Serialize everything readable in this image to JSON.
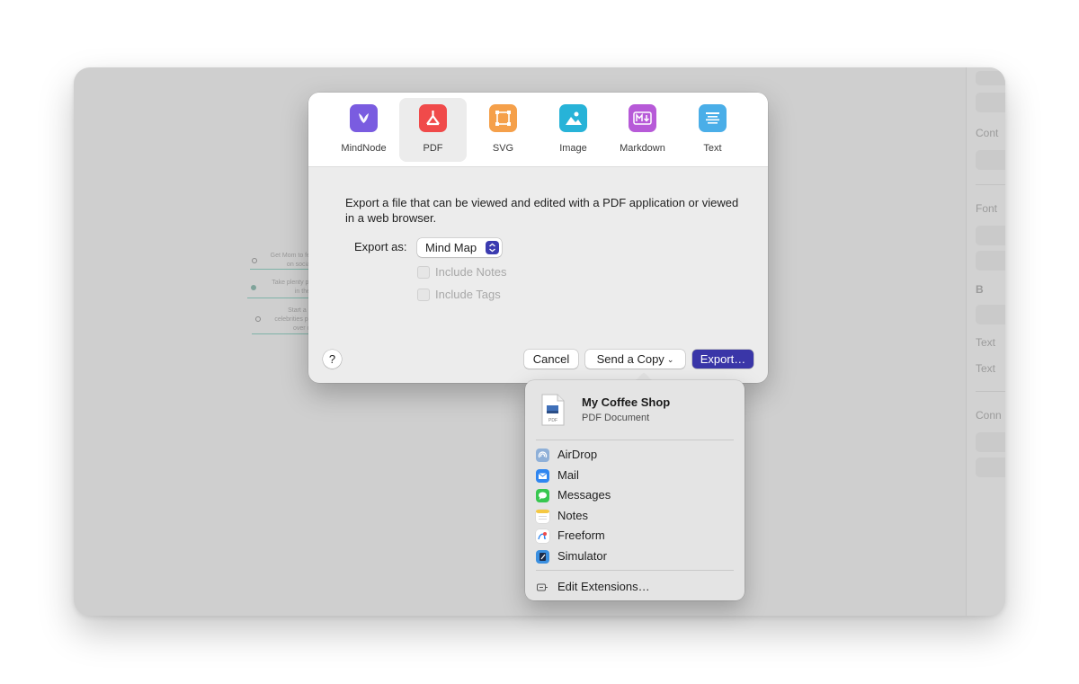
{
  "background_window": {
    "inspector_labels": [
      "Cont",
      "Font",
      "B",
      "Text",
      "Text",
      "Conn"
    ],
    "mindmap_nodes": [
      {
        "text": "Get Mom to fe",
        "text2": "on socia"
      },
      {
        "text": "Take plenty pi",
        "text2": "in the"
      },
      {
        "text": "Start a r",
        "text2": "celebrities pr",
        "text3": "over c"
      }
    ]
  },
  "dialog": {
    "tabs": [
      {
        "label": "MindNode",
        "icon": "mindnode-icon",
        "color": "#7a5ce0"
      },
      {
        "label": "PDF",
        "icon": "pdf-icon",
        "color": "#f04a4a",
        "selected": true
      },
      {
        "label": "SVG",
        "icon": "svg-icon",
        "color": "#f5a04a"
      },
      {
        "label": "Image",
        "icon": "image-icon",
        "color": "#27b3d8"
      },
      {
        "label": "Markdown",
        "icon": "markdown-icon",
        "color": "#b75ad8"
      },
      {
        "label": "Text",
        "icon": "text-icon",
        "color": "#4aaee8"
      }
    ],
    "description": "Export a file that can be viewed and edited with a PDF application or viewed in a web browser.",
    "export_as_label": "Export as:",
    "export_as_value": "Mind Map",
    "options": [
      {
        "label": "Include Notes",
        "checked": false,
        "enabled": false
      },
      {
        "label": "Include Tags",
        "checked": false,
        "enabled": false
      }
    ],
    "help_label": "?",
    "cancel_label": "Cancel",
    "send_copy_label": "Send a Copy",
    "export_label": "Export…",
    "accent_color": "#3a36a8"
  },
  "share_menu": {
    "doc_title": "My Coffee Shop",
    "doc_subtitle": "PDF Document",
    "doc_icon_label": "PDF",
    "items": [
      {
        "label": "AirDrop",
        "icon": "airdrop-icon"
      },
      {
        "label": "Mail",
        "icon": "mail-icon"
      },
      {
        "label": "Messages",
        "icon": "messages-icon"
      },
      {
        "label": "Notes",
        "icon": "notes-icon"
      },
      {
        "label": "Freeform",
        "icon": "freeform-icon"
      },
      {
        "label": "Simulator",
        "icon": "simulator-icon"
      }
    ],
    "edit_extensions_label": "Edit Extensions…"
  }
}
